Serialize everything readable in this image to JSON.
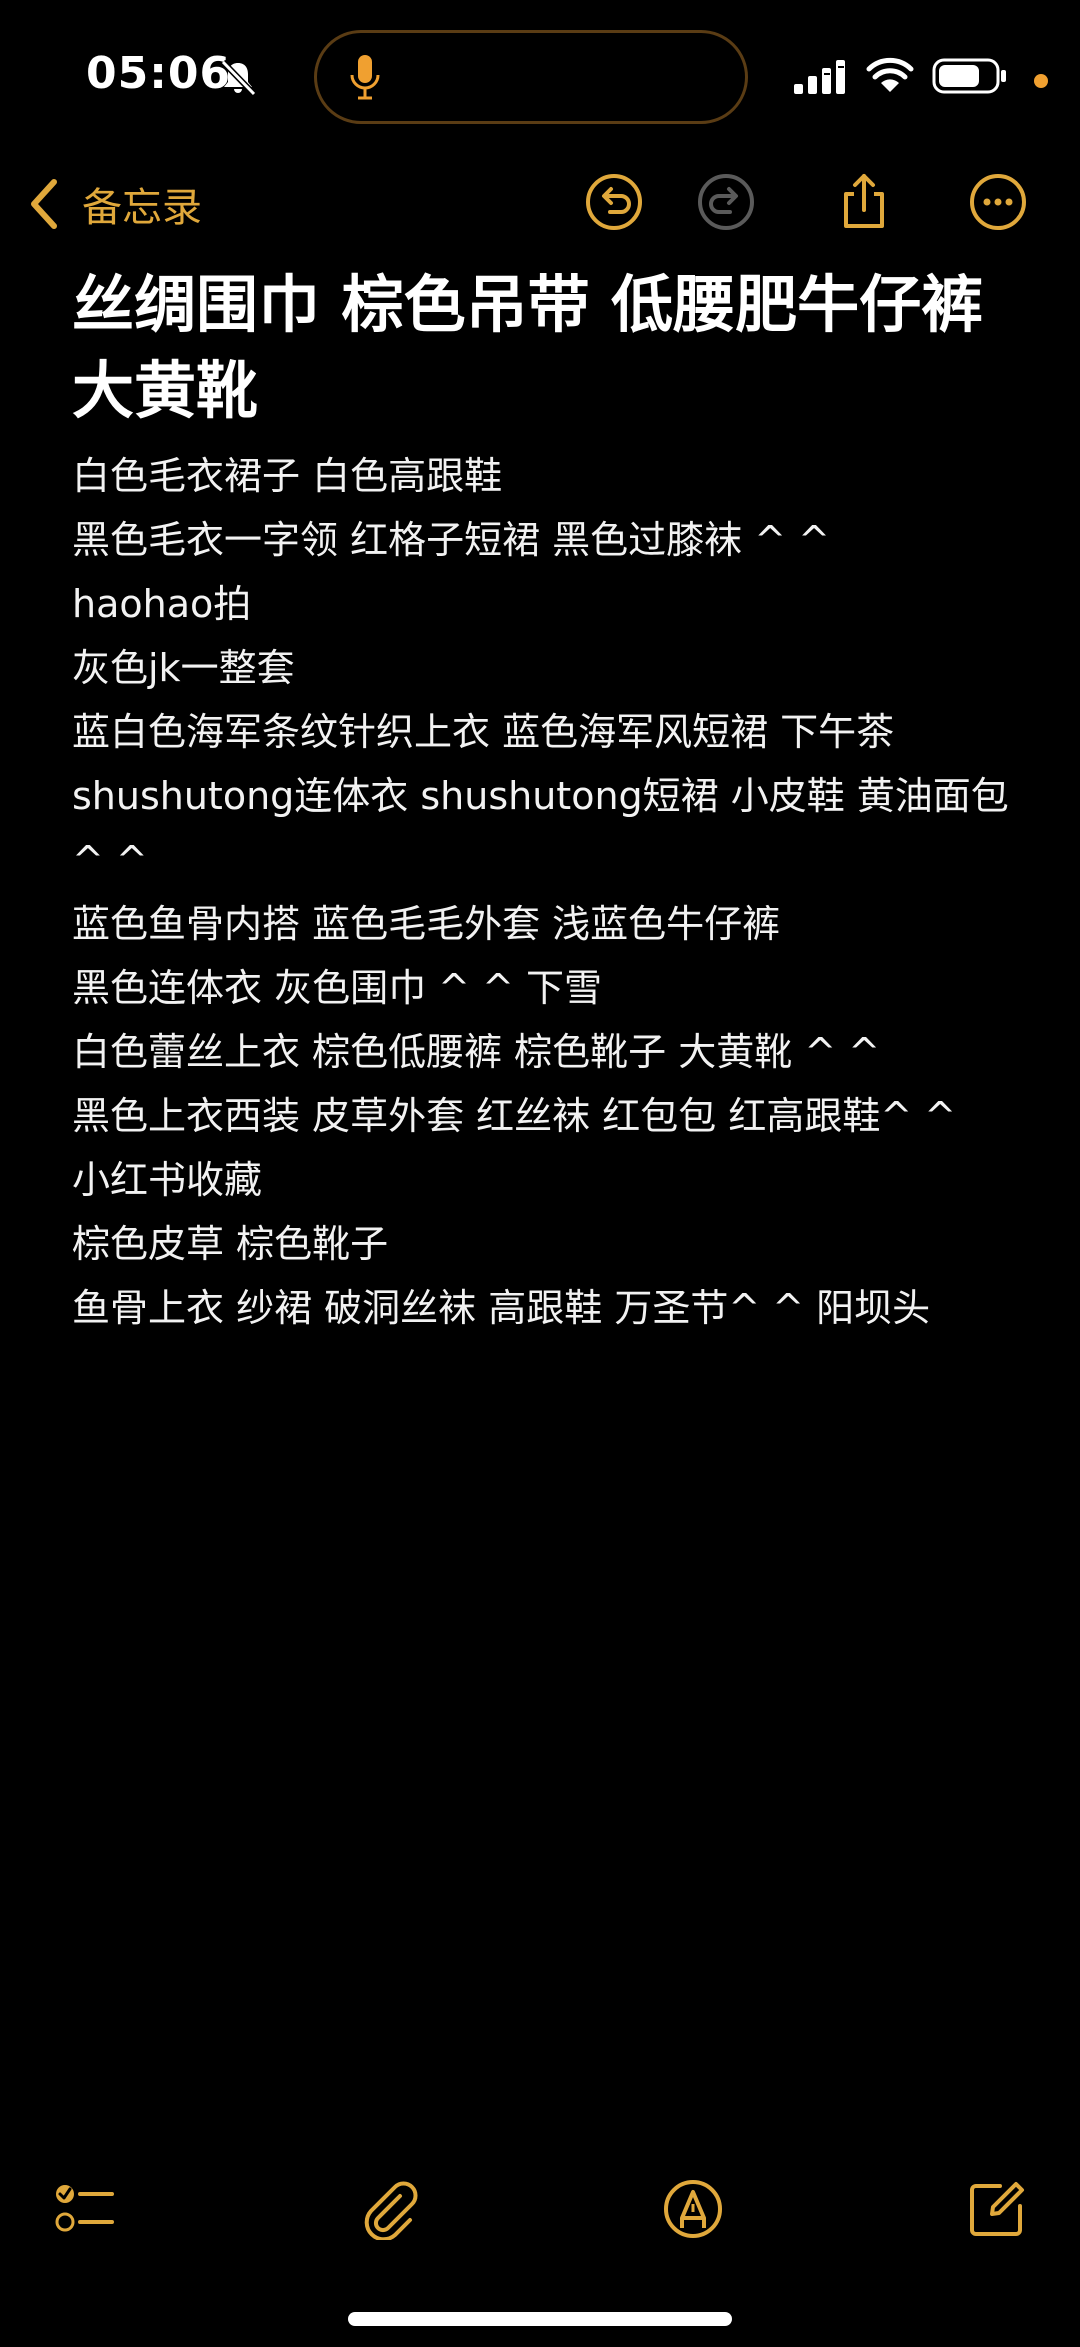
{
  "status_bar": {
    "time": "05:06"
  },
  "nav": {
    "back_label": "备忘录"
  },
  "note": {
    "title": "丝绸围巾  棕色吊带 低腰肥牛仔裤 大黄靴",
    "lines": [
      "白色毛衣裙子 白色高跟鞋",
      "黑色毛衣一字领 红格子短裙 黑色过膝袜 ^ ^",
      "haohao拍",
      "灰色jk一整套",
      "蓝白色海军条纹针织上衣 蓝色海军风短裙  下午茶",
      "shushutong连体衣 shushutong短裙  小皮鞋 黄油面包 ^ ^",
      "蓝色鱼骨内搭 蓝色毛毛外套 浅蓝色牛仔裤",
      "黑色连体衣 灰色围巾 ^ ^ 下雪",
      "白色蕾丝上衣 棕色低腰裤 棕色靴子 大黄靴 ^ ^",
      "黑色上衣西装 皮草外套 红丝袜 红包包 红高跟鞋^ ^",
      "小红书收藏",
      "棕色皮草 棕色靴子",
      "鱼骨上衣 纱裙 破洞丝袜 高跟鞋 万圣节^ ^ 阳坝头"
    ]
  },
  "icons": {
    "status": [
      "bell-slash-icon",
      "microphone-icon",
      "cellular-signal-icon",
      "wifi-icon",
      "battery-icon"
    ],
    "nav": [
      "chevron-left-icon",
      "undo-icon",
      "redo-icon",
      "share-icon",
      "more-icon"
    ],
    "toolbar": [
      "checklist-icon",
      "paperclip-icon",
      "markup-pen-icon",
      "compose-icon"
    ]
  },
  "colors": {
    "accent": "#e0a83b",
    "background": "#000000",
    "text": "#ffffff",
    "disabled": "#5a5a5a",
    "privacy_dot": "#f0a030"
  }
}
